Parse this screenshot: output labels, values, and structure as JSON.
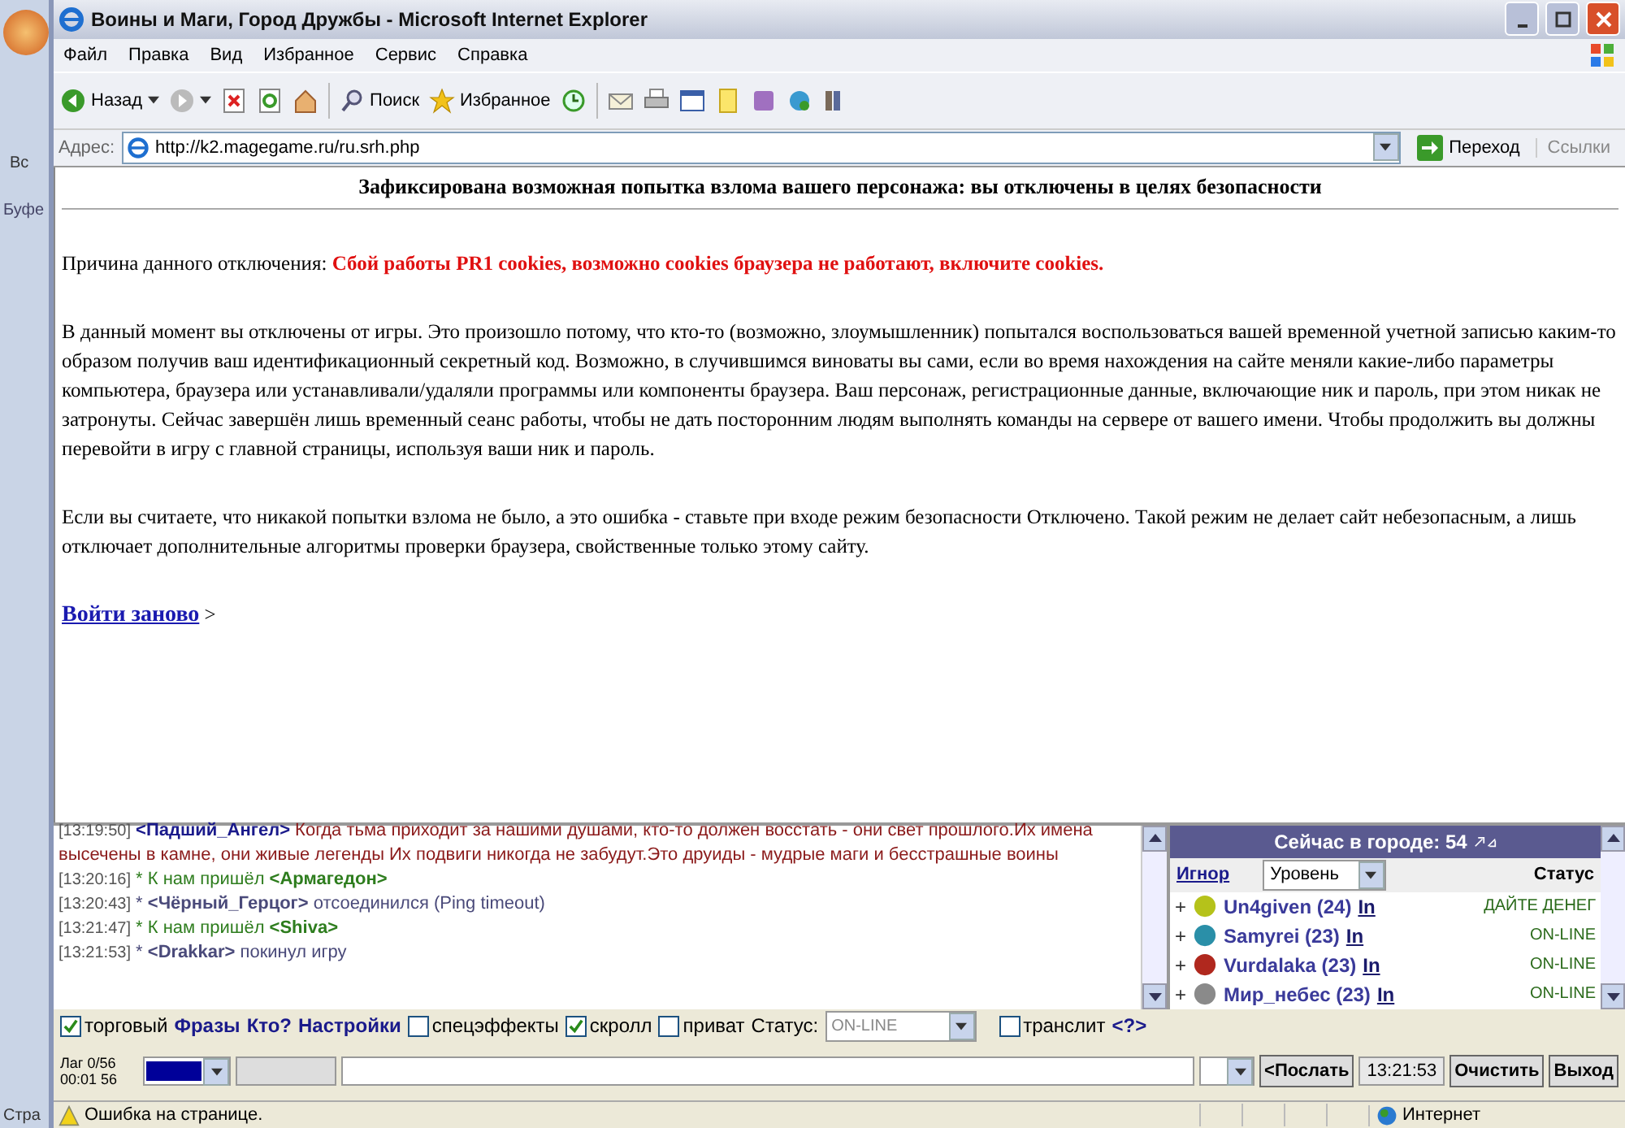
{
  "background_window": {
    "labels": [
      "Вс",
      "Буфе",
      "Стра"
    ]
  },
  "window": {
    "title": "Воины и Маги, Город Дружбы - Microsoft Internet Explorer"
  },
  "menu": [
    "Файл",
    "Правка",
    "Вид",
    "Избранное",
    "Сервис",
    "Справка"
  ],
  "toolbar": {
    "back": "Назад",
    "search": "Поиск",
    "favorites": "Избранное"
  },
  "address_bar": {
    "label": "Адрес:",
    "value": "http://k2.magegame.ru/ru.srh.php",
    "go": "Переход",
    "links": "Ссылки"
  },
  "page": {
    "heading": "Зафиксирована возможная попытка взлома вашего персонажа: вы отключены в целях безопасности",
    "reason_label": "Причина данного отключения:",
    "reason": "Сбой работы PR1 cookies, возможно cookies браузера не работают, включите cookies.",
    "paragraphs": [
      "В данный момент вы отключены от игры. Это произошло потому, что кто-то (возможно, злоумышленник) попытался воспользоваться вашей временной учетной записью каким-то образом получив ваш идентификационный секретный код. Возможно, в случившимся виноваты вы сами, если во время нахождения на сайте меняли какие-либо параметры компьютера, браузера или устанавливали/удаляли программы или компоненты браузера. Ваш персонаж, регистрационные данные, включающие ник и пароль, при этом никак не затронуты. Сейчас завершён лишь временный сеанс работы, чтобы не дать посторонним людям выполнять команды на сервере от вашего имени. Чтобы продолжить вы должны перевойти в игру с главной страницы, используя ваши ник и пароль.",
      "Если вы считаете, что никакой попытки взлома не было, а это ошибка - ставьте при входе режим безопасности Отключено. Такой режим не делает сайт небезопасным, а лишь отключает дополнительные алгоритмы проверки браузера, свойственные только этому сайту."
    ],
    "relogin_link": "Войти заново",
    "relogin_arrow": ">"
  },
  "chat": [
    {
      "kind": "message",
      "time": "[13:19:50]",
      "nick": "<Падший_Ангел>",
      "text": "Когда тьма приходит за нашими душами, кто-то должен восстать - они свет прошлого.Их имена высечены в камне, они живые легенды Их подвиги никогда не забудут.Это друиды - мудрые маги и бесстрашные воины"
    },
    {
      "kind": "join",
      "time": "[13:20:16]",
      "text": "* К нам пришёл **<Армагедон>**"
    },
    {
      "kind": "leave",
      "time": "[13:20:43]",
      "text": "* **<Чёрный_Герцог>** отсоединился (Ping timeout)"
    },
    {
      "kind": "join",
      "time": "[13:21:47]",
      "text": "* К нам пришёл **<Shiva>**"
    },
    {
      "kind": "leave",
      "time": "[13:21:53]",
      "text": "* **<Drakkar>** покинул игру"
    }
  ],
  "online": {
    "title": "Сейчас в городе: 54",
    "ignore": "Игнор",
    "sort": "Уровень",
    "status": "Статус",
    "players": [
      {
        "plus": "+",
        "name": "Un4given (24)",
        "info": "In",
        "status": "ДАЙТЕ ДЕНЕГ",
        "color": "#b5c21a"
      },
      {
        "plus": "+",
        "name": "Samyrei (23)",
        "info": "In",
        "status": "ON-LINE",
        "color": "#2a8fa8"
      },
      {
        "plus": "+",
        "name": "Vurdalaka (23)",
        "info": "In",
        "status": "ON-LINE",
        "color": "#b0281e"
      },
      {
        "plus": "+",
        "name": "Мир_небес (23)",
        "info": "In",
        "status": "ON-LINE",
        "color": "#8a8a8a"
      }
    ]
  },
  "options": [
    {
      "kind": "checkbox",
      "label": "торговый",
      "checked": true
    },
    {
      "kind": "link",
      "label": "Фразы"
    },
    {
      "kind": "link",
      "label": "Кто?"
    },
    {
      "kind": "link",
      "label": "Настройки"
    },
    {
      "kind": "checkbox",
      "label": "спецэффекты",
      "checked": false
    },
    {
      "kind": "checkbox",
      "label": "скролл",
      "checked": true
    },
    {
      "kind": "checkbox",
      "label": "приват",
      "checked": false
    },
    {
      "kind": "select",
      "label": "Статус:",
      "value": "ON-LINE"
    },
    {
      "kind": "checkbox",
      "label": "транслит",
      "checked": false
    },
    {
      "kind": "link",
      "label": "<?>"
    }
  ],
  "input_row": {
    "lag": "Лаг 0/56",
    "clock": "00:01 56",
    "color": "#000099",
    "send": "<Послать",
    "time": "13:21:53",
    "clear": "Очистить",
    "exit": "Выход"
  },
  "status_bar": {
    "message": "Ошибка на странице.",
    "zone": "Интернет"
  }
}
